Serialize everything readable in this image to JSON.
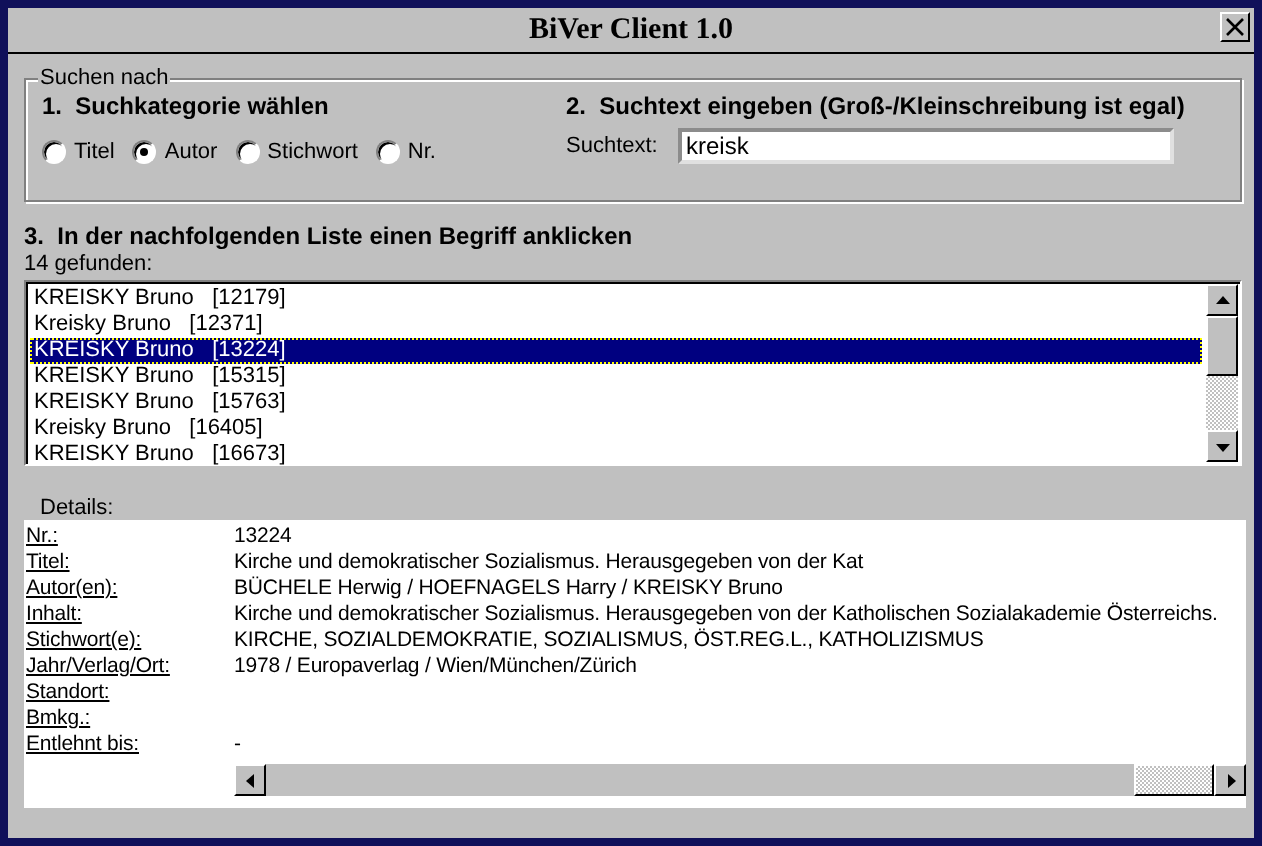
{
  "window": {
    "title": "BiVer Client 1.0"
  },
  "search_group": {
    "title": "Suchen nach",
    "step_1": "1.  Suchkategorie wählen",
    "step_2": "2.  Suchtext eingeben (Groß-/Kleinschreibung ist egal)",
    "categories": [
      {
        "label": "Titel",
        "selected": false
      },
      {
        "label": "Autor",
        "selected": true
      },
      {
        "label": "Stichwort",
        "selected": false
      },
      {
        "label": "Nr.",
        "selected": false
      }
    ],
    "search_label": "Suchtext:",
    "search_value": "kreisk"
  },
  "step_3": "3.  In der nachfolgenden Liste einen Begriff anklicken",
  "result_count": "14 gefunden:",
  "results": [
    {
      "text": "KREISKY Bruno   [12179]",
      "selected": false
    },
    {
      "text": "Kreisky Bruno   [12371]",
      "selected": false
    },
    {
      "text": "KREISKY Bruno   [13224]",
      "selected": true
    },
    {
      "text": "KREISKY Bruno   [15315]",
      "selected": false
    },
    {
      "text": "KREISKY Bruno   [15763]",
      "selected": false
    },
    {
      "text": "Kreisky Bruno   [16405]",
      "selected": false
    },
    {
      "text": "KREISKY Bruno   [16673]",
      "selected": false
    }
  ],
  "details": {
    "title": "Details:",
    "rows": [
      {
        "label": "Nr.:",
        "value": "13224"
      },
      {
        "label": "Titel:",
        "value": "Kirche und demokratischer Sozialismus. Herausgegeben von der Kat"
      },
      {
        "label": "Autor(en):",
        "value": "BÜCHELE Herwig / HOEFNAGELS Harry / KREISKY Bruno"
      },
      {
        "label": "Inhalt:",
        "value": "Kirche und demokratischer Sozialismus. Herausgegeben von der Katholischen Sozialakademie Österreichs."
      },
      {
        "label": "Stichwort(e):",
        "value": "KIRCHE, SOZIALDEMOKRATIE, SOZIALISMUS, ÖST.REG.L., KATHOLIZISMUS"
      },
      {
        "label": "Jahr/Verlag/Ort:",
        "value": "1978 / Europaverlag / Wien/München/Zürich"
      },
      {
        "label": "Standort:"
      },
      {
        "label": "Bmkg.:"
      },
      {
        "label": "Entlehnt bis:",
        "value": "-"
      }
    ]
  }
}
